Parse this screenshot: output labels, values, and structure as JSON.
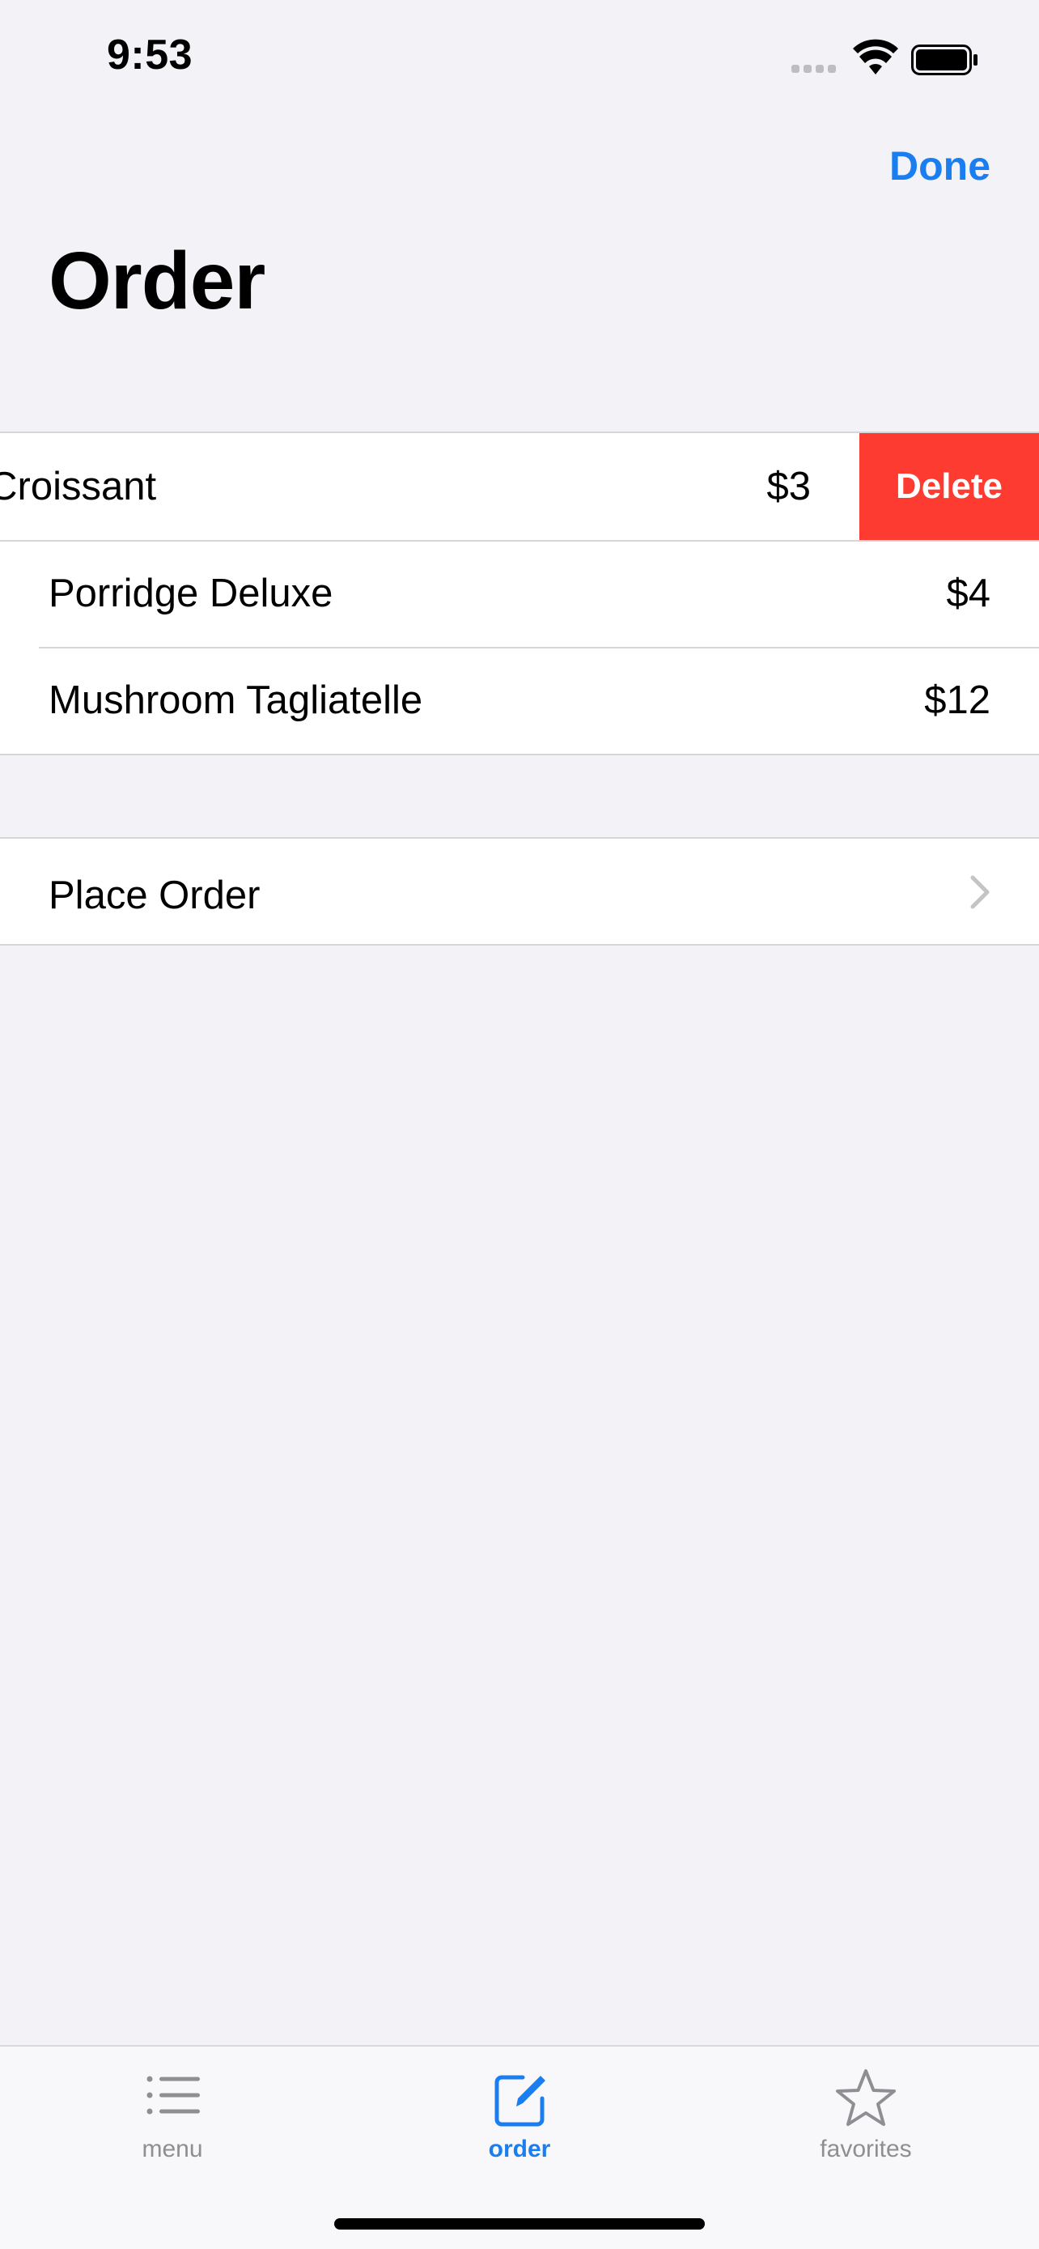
{
  "status_bar": {
    "time": "9:53",
    "icons": [
      "cellular-signal-icon",
      "wifi-icon",
      "battery-icon"
    ]
  },
  "nav": {
    "done_label": "Done",
    "title": "Order"
  },
  "order_items": [
    {
      "name": "Baked Croissant",
      "price": "$3",
      "swiped": true,
      "visible_name": "baked Croissant"
    },
    {
      "name": "Porridge Deluxe",
      "price": "$4",
      "swiped": false
    },
    {
      "name": "Mushroom Tagliatelle",
      "price": "$12",
      "swiped": false
    }
  ],
  "delete_label": "Delete",
  "place_order": {
    "label": "Place Order",
    "icon": "chevron-right-icon"
  },
  "tabbar": {
    "tabs": [
      {
        "label": "menu",
        "icon": "list-icon",
        "active": false
      },
      {
        "label": "order",
        "icon": "compose-icon",
        "active": true
      },
      {
        "label": "favorites",
        "icon": "star-icon",
        "active": false
      }
    ]
  },
  "colors": {
    "accent": "#1a7ef0",
    "delete": "#fd3b30",
    "background": "#f2f2f7",
    "inactive_tab": "#8e8e93"
  }
}
